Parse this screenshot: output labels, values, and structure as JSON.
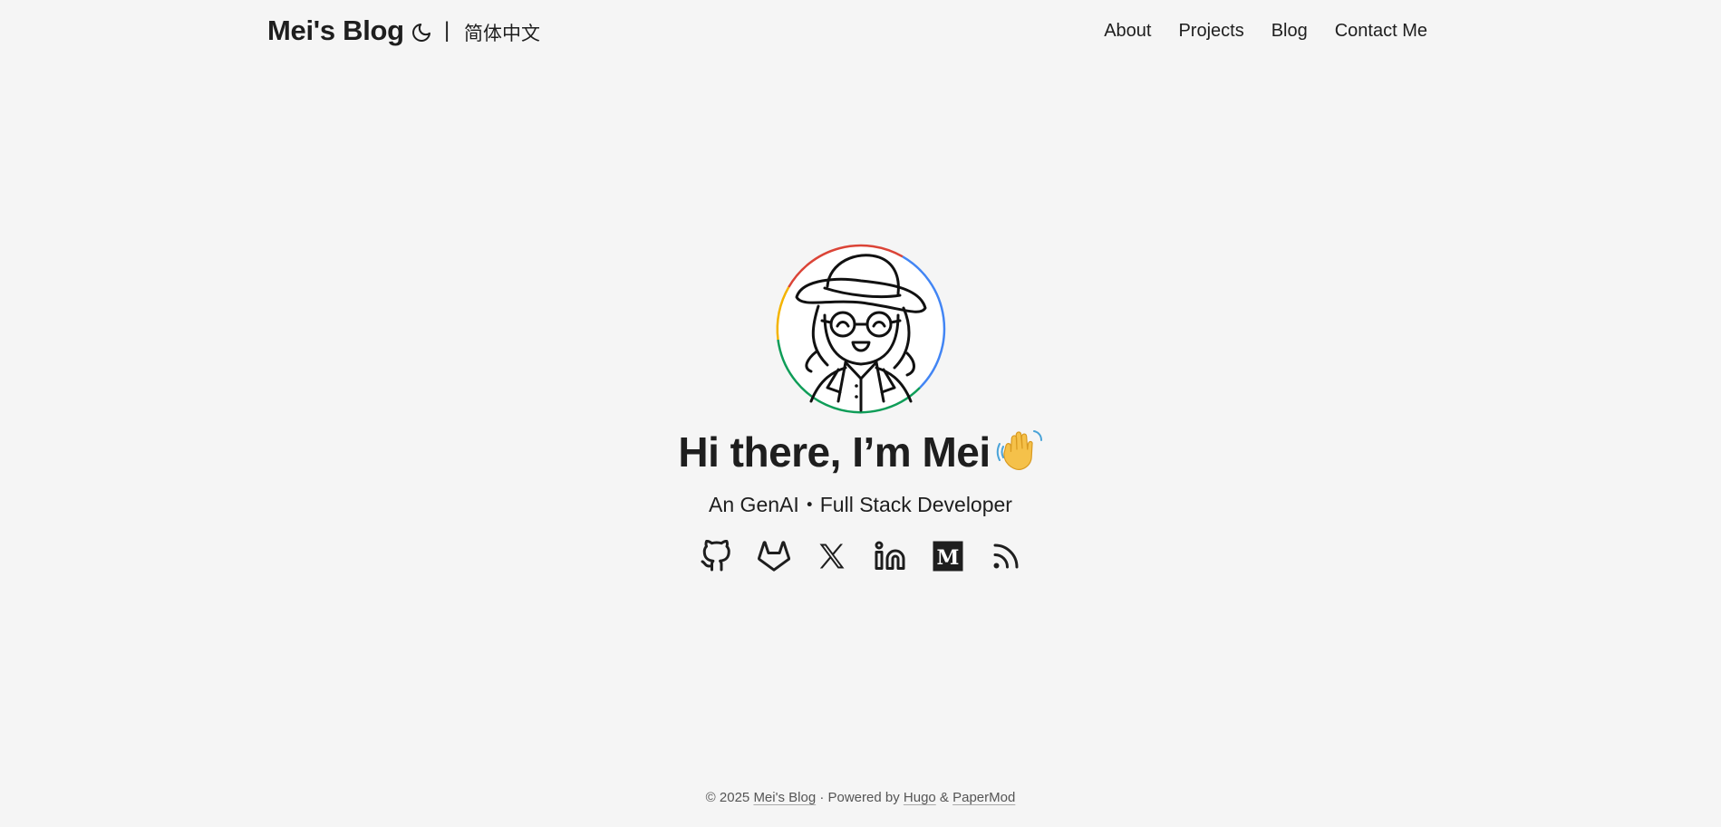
{
  "header": {
    "logo": "Mei's Blog",
    "theme_toggle_icon": "moon-icon",
    "lang_separator": "|",
    "lang_link": "简体中文",
    "nav": [
      {
        "label": "About"
      },
      {
        "label": "Projects"
      },
      {
        "label": "Blog"
      },
      {
        "label": "Contact Me"
      }
    ]
  },
  "hero": {
    "avatar_icon": "avatar-illustration",
    "title": "Hi there, I’m Mei",
    "wave_icon": "waving-hand-icon",
    "subtitle": "An GenAI・Full Stack Developer",
    "socials": [
      {
        "icon": "github-icon"
      },
      {
        "icon": "gitlab-icon"
      },
      {
        "icon": "x-icon"
      },
      {
        "icon": "linkedin-icon"
      },
      {
        "icon": "medium-icon"
      },
      {
        "icon": "rss-icon"
      }
    ]
  },
  "footer": {
    "copyright": "© 2025",
    "site_link": "Mei's Blog",
    "powered_by": "· Powered by",
    "hugo": "Hugo",
    "amp": "&",
    "papermod": "PaperMod"
  },
  "colors": {
    "background": "#f5f5f5",
    "text": "#1e1e1e",
    "ring_red": "#db4437",
    "ring_blue": "#4285f4",
    "ring_green": "#0f9d58",
    "ring_yellow": "#f4b400"
  }
}
